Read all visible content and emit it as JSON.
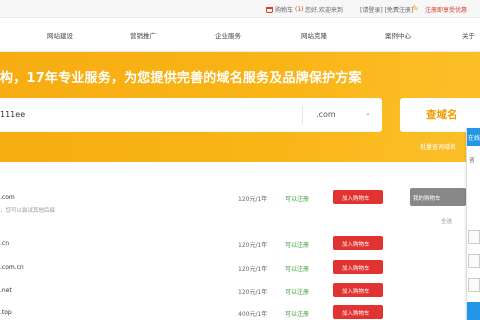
{
  "topbar": {
    "cart_count": "(1)",
    "cart_label": "购物车",
    "welcome": "您好,欢迎来到",
    "login": "[请登录] [免费注册]",
    "promo": "注册即享受优惠"
  },
  "nav": {
    "items": [
      "网站建设",
      "营销推广",
      "企业服务",
      "网站克隆",
      "案例中心",
      "关于"
    ]
  },
  "banner": {
    "slogan": "构，17年专业服务，为您提供完善的域名服务及品牌保护方案",
    "search_value": "111ee",
    "suffix": ".com",
    "search_button": "查域名",
    "batch_link": "批量查询域名"
  },
  "results": {
    "rows": [
      {
        "domain": ".com",
        "note": "，您可以尝试其他后缀",
        "price": "120元/1年",
        "status": "可以注册",
        "button": "加入购物车"
      },
      {
        "domain": ".cn",
        "note": "",
        "price": "120元/1年",
        "status": "可以注册",
        "button": "加入购物车"
      },
      {
        "domain": ".com.cn",
        "note": "",
        "price": "120元/1年",
        "status": "可以注册",
        "button": "加入购物车"
      },
      {
        "domain": ".net",
        "note": "",
        "price": "120元/1年",
        "status": "可以注册",
        "button": "加入购物车"
      },
      {
        "domain": ".top",
        "note": "",
        "price": "400元/1年",
        "status": "可以注册",
        "button": "加入购物车"
      }
    ]
  },
  "side": {
    "box_label": "我的购物车",
    "link": "全选"
  },
  "float_panel": {
    "head": "在线",
    "text": "咨"
  }
}
